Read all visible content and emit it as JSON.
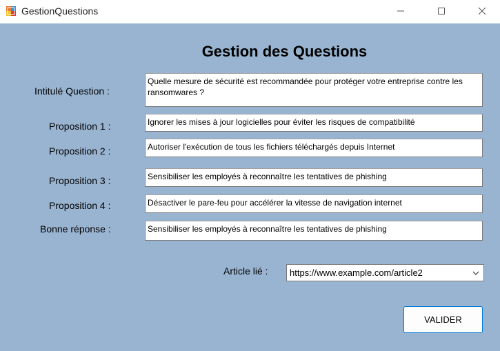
{
  "window": {
    "title": "GestionQuestions"
  },
  "form": {
    "heading": "Gestion des Questions",
    "fields": [
      {
        "label": "Intitulé Question :",
        "value": "Quelle mesure de sécurité est recommandée pour protéger votre entreprise contre les ransomwares ?"
      },
      {
        "label": "Proposition 1 :",
        "value": "Ignorer les mises à jour logicielles pour éviter les risques de compatibilité"
      },
      {
        "label": "Proposition 2 :",
        "value": "Autoriser l'exécution de tous les fichiers téléchargés depuis Internet"
      },
      {
        "label": "Proposition 3 :",
        "value": "Sensibiliser les employés à reconnaître les tentatives de phishing"
      },
      {
        "label": "Proposition 4 :",
        "value": "Désactiver le pare-feu pour accélérer la vitesse de navigation internet"
      },
      {
        "label": "Bonne réponse :",
        "value": "Sensibiliser les employés à reconnaître les tentatives de phishing"
      }
    ],
    "article": {
      "label": "Article lié :",
      "selected": "https://www.example.com/article2"
    },
    "submit_label": "VALIDER"
  },
  "icons": [
    "app-icon",
    "minimize-icon",
    "maximize-icon",
    "close-icon",
    "chevron-down-icon"
  ],
  "colors": {
    "background": "#99b4d1",
    "button_border": "#0078d7"
  }
}
